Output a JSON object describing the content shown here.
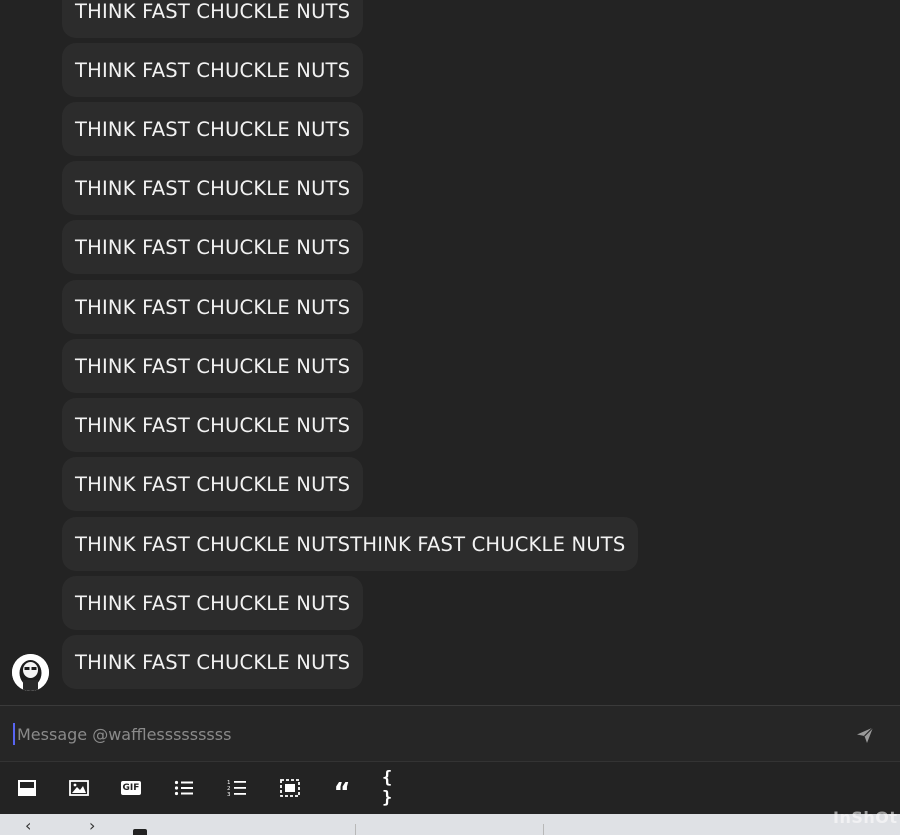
{
  "messages": [
    "THINK FAST CHUCKLE NUTS",
    "THINK FAST CHUCKLE NUTS",
    "THINK FAST CHUCKLE NUTS",
    "THINK FAST CHUCKLE NUTS",
    "THINK FAST CHUCKLE NUTS",
    "THINK FAST CHUCKLE NUTS",
    "THINK FAST CHUCKLE NUTS",
    "THINK FAST CHUCKLE NUTS",
    "THINK FAST CHUCKLE NUTS",
    "THINK FAST CHUCKLE NUTSTHINK FAST CHUCKLE NUTS",
    "THINK FAST CHUCKLE NUTS",
    "THINK FAST CHUCKLE NUTS"
  ],
  "composer": {
    "placeholder": "Message @wafflesssssssss"
  },
  "toolbar": {
    "gif_label": "GIF",
    "quote_label": "“",
    "code_label": "{ }"
  },
  "watermark": "InShOt",
  "colors": {
    "background": "#232323",
    "bubble": "#2c2c2c",
    "caret": "#5865f2"
  }
}
